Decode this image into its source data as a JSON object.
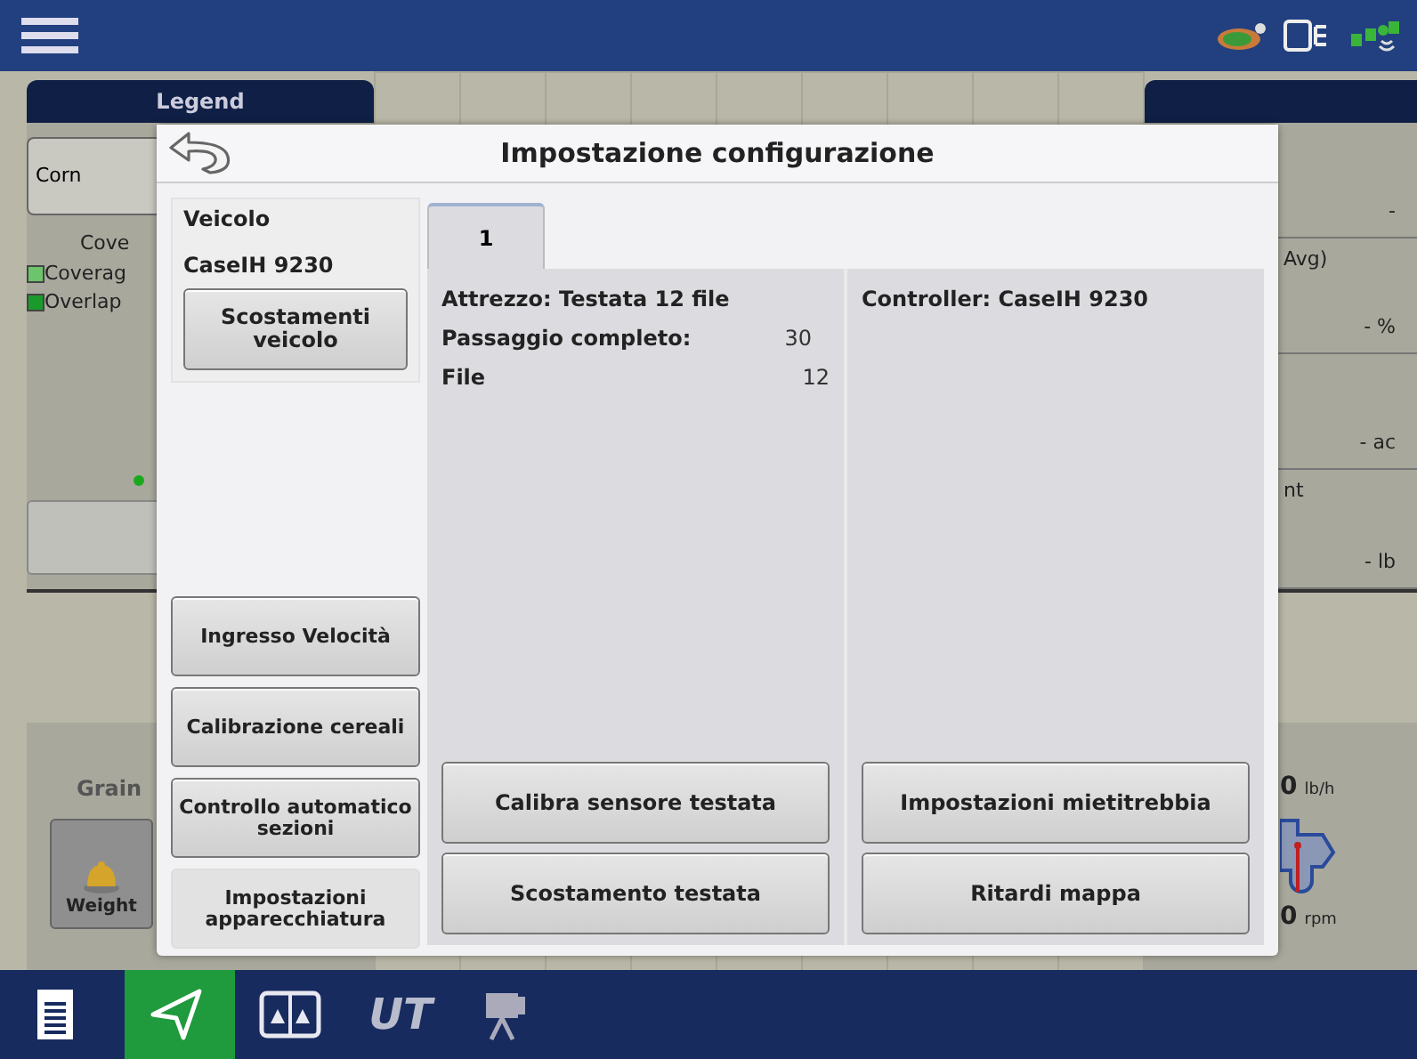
{
  "left_panel": {
    "tab": "Legend",
    "crop_button": "Corn",
    "coverage_heading": "Cove",
    "legend": [
      {
        "label": "Coverag",
        "color": "#6cc46c"
      },
      {
        "label": "Overlap",
        "color": "#1a9a2a"
      }
    ],
    "grain_heading": "Grain",
    "weight_button": "Weight"
  },
  "right_panel": {
    "rows": [
      {
        "label": "",
        "value": "-"
      },
      {
        "label": "Avg)",
        "value": "- %"
      },
      {
        "label": "",
        "value": "- ac"
      },
      {
        "label": "nt",
        "value": "- lb"
      }
    ],
    "gauge_top": {
      "value": "0",
      "unit": "lb/h"
    },
    "gauge_bottom": {
      "value": "0",
      "unit": "rpm"
    }
  },
  "dialog": {
    "title": "Impostazione configurazione",
    "vehicle": {
      "heading": "Veicolo",
      "name": "CaseIH 9230",
      "button": "Scostamenti veicolo"
    },
    "side_buttons": [
      {
        "label": "Ingresso Velocità",
        "selected": false
      },
      {
        "label": "Calibrazione cereali",
        "selected": false
      },
      {
        "label": "Controllo automatico sezioni",
        "selected": false
      },
      {
        "label": "Impostazioni apparecchiatura",
        "selected": true
      }
    ],
    "tabs": [
      {
        "label": "1",
        "selected": true
      }
    ],
    "implement": {
      "title": "Attrezzo: Testata 12 file",
      "rows": [
        {
          "label": "Passaggio completo:",
          "value": "30"
        },
        {
          "label": "File",
          "value": "12"
        }
      ],
      "buttons": [
        "Calibra sensore testata",
        "Scostamento testata"
      ]
    },
    "controller": {
      "title": "Controller: CaseIH 9230",
      "buttons": [
        "Impostazioni mietitrebbia",
        "Ritardi mappa"
      ]
    }
  },
  "bottom_bar": [
    {
      "kind": "document",
      "selected": false
    },
    {
      "kind": "navigation",
      "selected": true
    },
    {
      "kind": "split",
      "selected": false
    },
    {
      "kind": "ut",
      "label": "UT",
      "selected": false
    },
    {
      "kind": "camera",
      "selected": false
    }
  ]
}
